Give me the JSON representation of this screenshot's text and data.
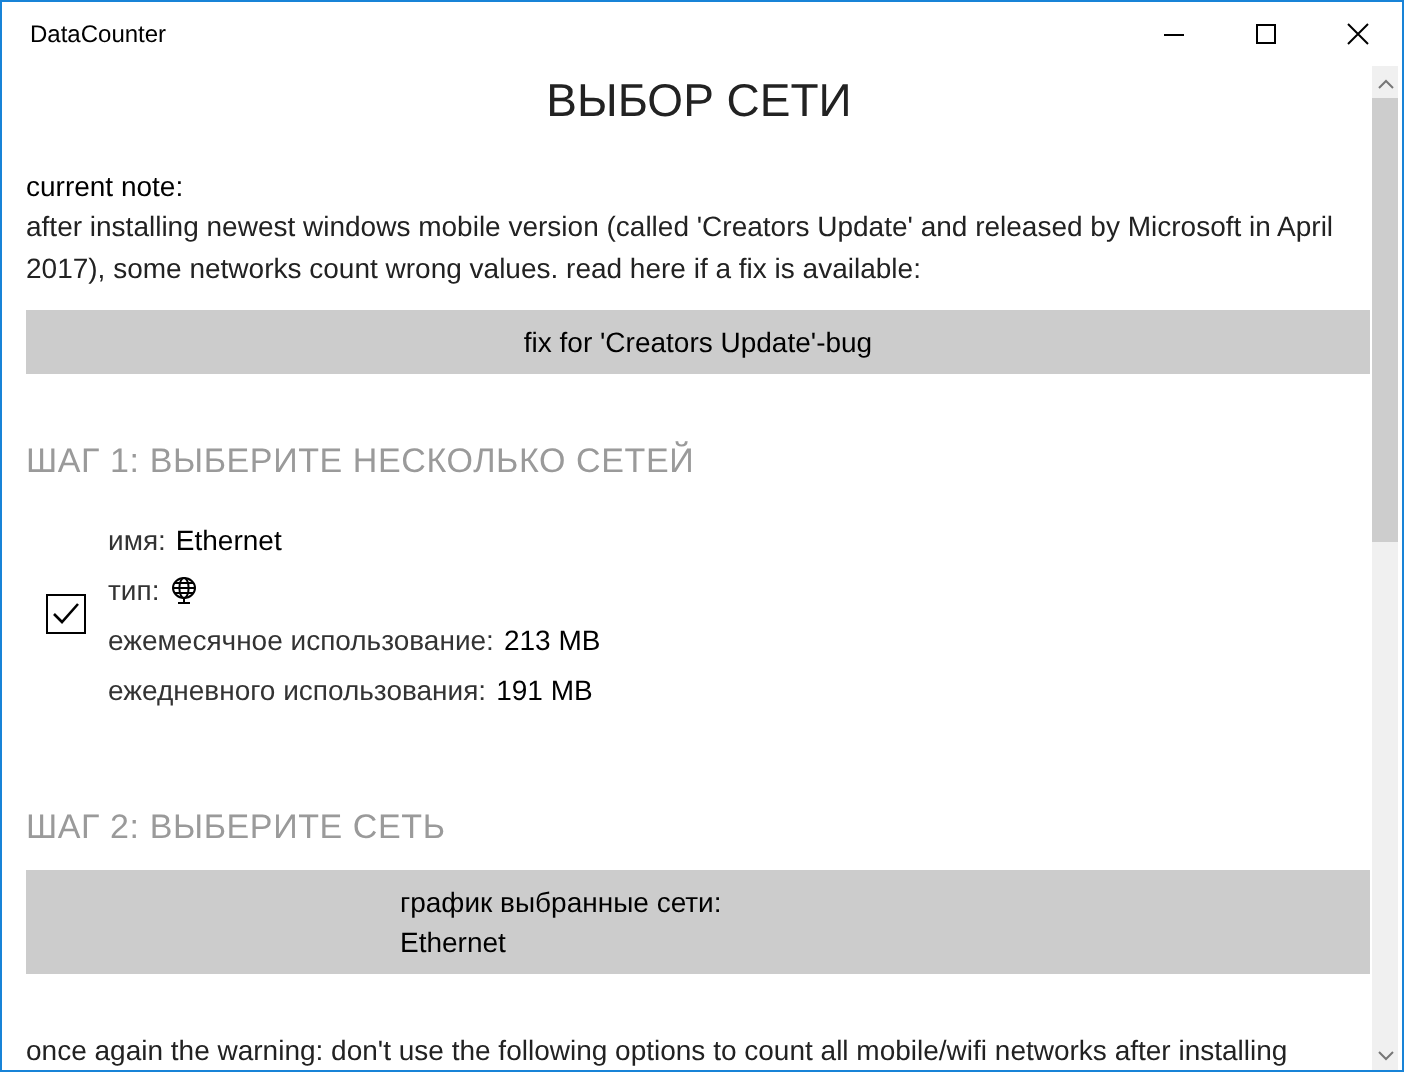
{
  "window": {
    "title": "DataCounter"
  },
  "heading": "ВЫБОР СЕТИ",
  "note": {
    "title": "current note:",
    "text": "after installing newest windows mobile version (called 'Creators Update' and released by Microsoft in April 2017), some networks count wrong values. read here if a fix is available:"
  },
  "fix_button": {
    "label": "fix for 'Creators Update'-bug"
  },
  "step1": {
    "title": "ШАГ 1: ВЫБЕРИТЕ НЕСКОЛЬКО СЕТЕЙ"
  },
  "networks": [
    {
      "checked": true,
      "name_label": "имя:",
      "name": "Ethernet",
      "type_label": "тип:",
      "monthly_label": "ежемесячное использование:",
      "monthly": "213 MB",
      "daily_label": "ежедневного использования:",
      "daily": "191 MB"
    }
  ],
  "step2": {
    "title": "ШАГ 2: ВЫБЕРИТЕ СЕТЬ"
  },
  "chart_button": {
    "lines": [
      "график выбранные сети:",
      "Ethernet"
    ]
  },
  "warning": "once again the warning: don't use the following options to count all mobile/wifi networks after installing"
}
